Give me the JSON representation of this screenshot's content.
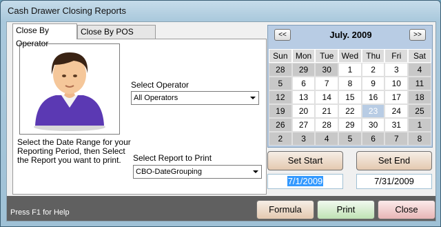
{
  "window": {
    "title": "Cash Drawer Closing Reports"
  },
  "tabs": [
    {
      "label": "Close By Operator"
    },
    {
      "label": "Close By POS Station"
    }
  ],
  "operator": {
    "select_label": "Select Operator",
    "select_value": "All Operators",
    "report_label": "Select Report to Print",
    "report_value": "CBO-DateGrouping",
    "description": "Select the Date Range for your Reporting Period, then Select the Report you want to print."
  },
  "calendar": {
    "month_label": "July. 2009",
    "prev_label": "<<",
    "next_label": ">>",
    "weekday_labels": [
      "Sun",
      "Mon",
      "Tue",
      "Wed",
      "Thu",
      "Fri",
      "Sat"
    ],
    "weeks": [
      [
        "28",
        "29",
        "30",
        "1",
        "2",
        "3",
        "4"
      ],
      [
        "5",
        "6",
        "7",
        "8",
        "9",
        "10",
        "11"
      ],
      [
        "12",
        "13",
        "14",
        "15",
        "16",
        "17",
        "18"
      ],
      [
        "19",
        "20",
        "21",
        "22",
        "23",
        "24",
        "25"
      ],
      [
        "26",
        "27",
        "28",
        "29",
        "30",
        "31",
        "1"
      ],
      [
        "2",
        "3",
        "4",
        "5",
        "6",
        "7",
        "8"
      ]
    ]
  },
  "dates": {
    "set_start_label": "Set Start",
    "set_end_label": "Set End",
    "start_value": "7/1/2009",
    "end_value": "7/31/2009"
  },
  "footer": {
    "help_text": "Press F1 for Help",
    "formula_label": "Formula",
    "print_label": "Print",
    "close_label": "Close"
  }
}
